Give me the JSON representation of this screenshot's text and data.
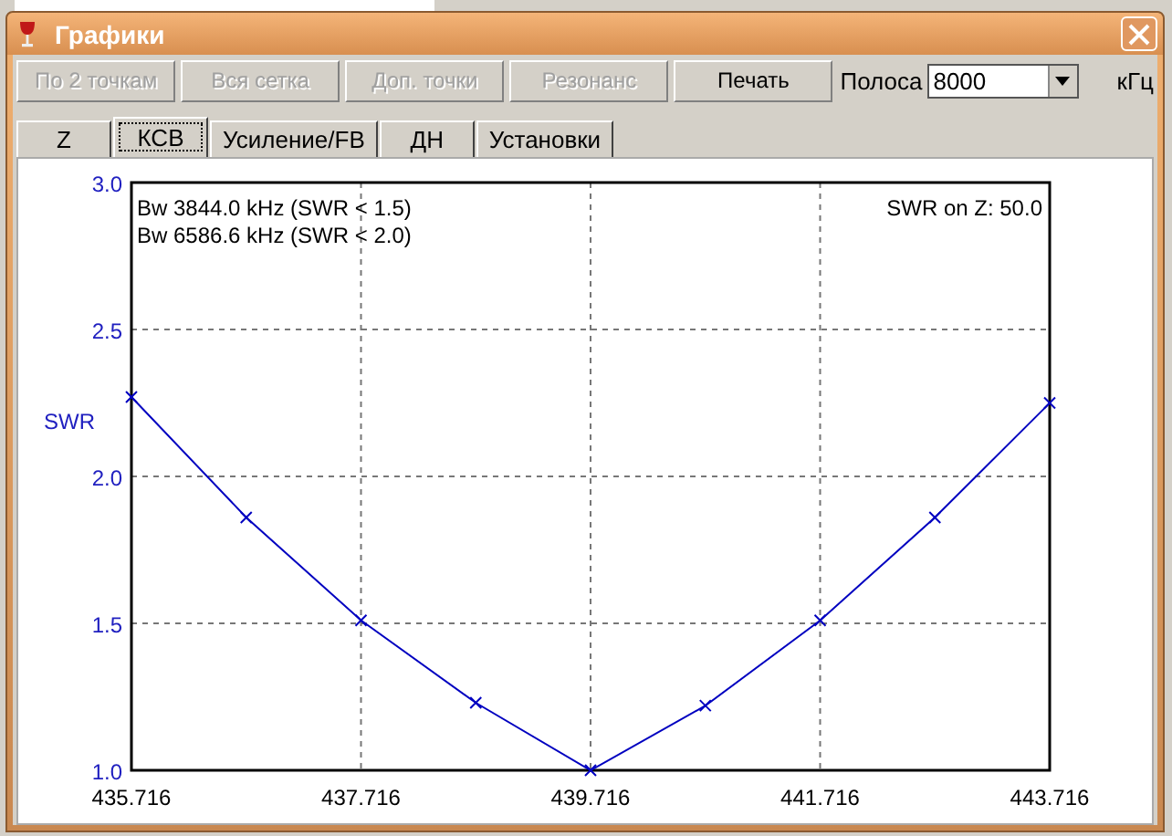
{
  "window": {
    "title": "Графики"
  },
  "toolbar": {
    "buttons": [
      {
        "label": "По 2 точкам",
        "disabled": true
      },
      {
        "label": "Вся сетка",
        "disabled": true
      },
      {
        "label": "Доп. точки",
        "disabled": true
      },
      {
        "label": "Резонанс",
        "disabled": true
      },
      {
        "label": "Печать",
        "disabled": false
      }
    ],
    "band_label": "Полоса",
    "band_value": "8000",
    "unit": "кГц"
  },
  "tabs": [
    {
      "label": "Z",
      "selected": false
    },
    {
      "label": "КСВ",
      "selected": true
    },
    {
      "label": "Усиление/FB",
      "selected": false
    },
    {
      "label": "ДН",
      "selected": false
    },
    {
      "label": "Установки",
      "selected": false
    }
  ],
  "plot": {
    "chart_data": {
      "type": "line",
      "ylabel": "SWR",
      "x": [
        435.716,
        436.716,
        437.716,
        438.716,
        439.716,
        440.716,
        441.716,
        442.716,
        443.716
      ],
      "grid": true,
      "series": [
        {
          "color": "#0000c0",
          "marker": "x",
          "values": [
            2.27,
            1.86,
            1.51,
            1.23,
            1.0,
            1.22,
            1.51,
            1.86,
            2.25
          ]
        }
      ],
      "xlim": [
        435.716,
        443.716
      ],
      "ylim": [
        1.0,
        3.0
      ],
      "xticks": [
        435.716,
        437.716,
        439.716,
        441.716,
        443.716
      ],
      "yticks": [
        {
          "value": 1.0,
          "label": "1.0"
        },
        {
          "value": 1.5,
          "label": "1.5"
        },
        {
          "value": 2.0,
          "label": "2.0"
        },
        {
          "value": 2.5,
          "label": "2.5"
        },
        {
          "value": 3.0,
          "label": "3.0"
        }
      ],
      "annotations": [
        "Bw 3844.0 kHz (SWR < 1.5)",
        "Bw 6586.6 kHz (SWR < 2.0)",
        "SWR on Z: 50.0"
      ]
    }
  }
}
